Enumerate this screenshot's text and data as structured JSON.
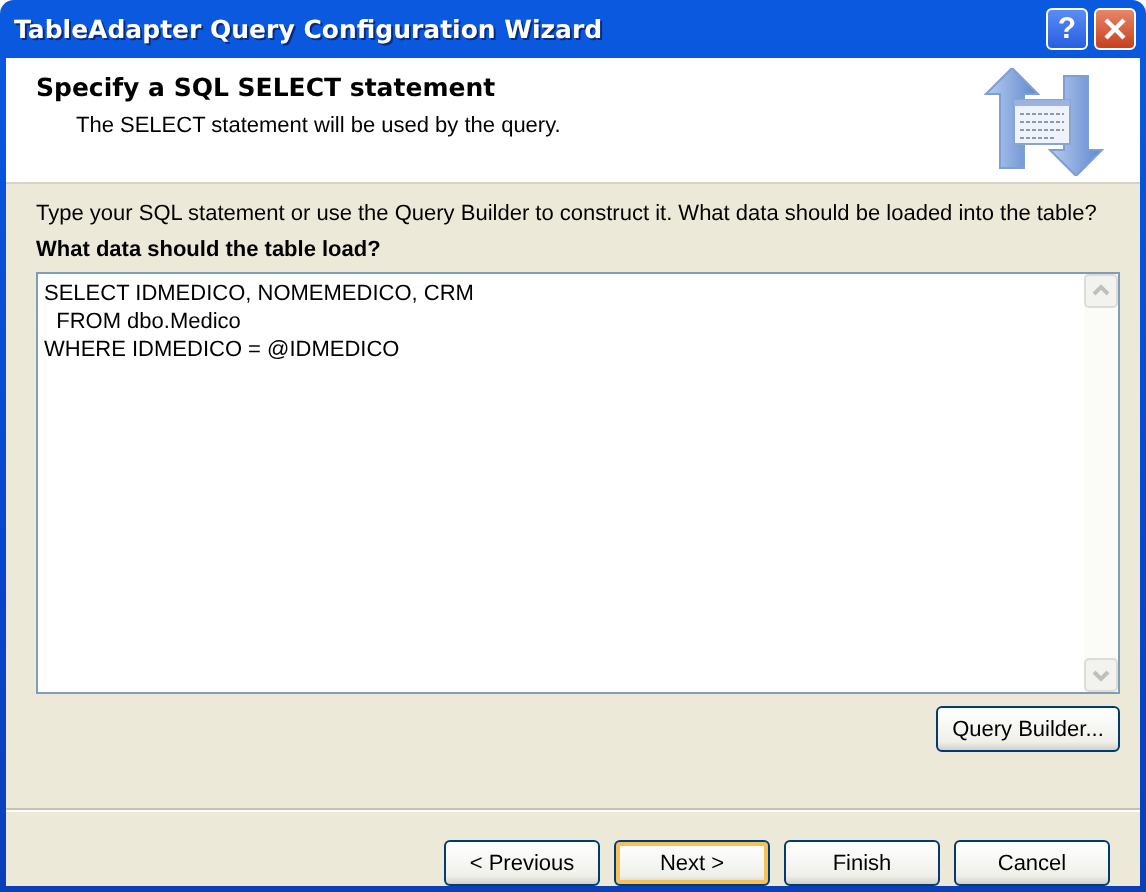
{
  "window": {
    "title": "TableAdapter Query Configuration Wizard",
    "controls": [
      {
        "kind": "help",
        "label": "?"
      },
      {
        "kind": "close"
      }
    ]
  },
  "header": {
    "title": "Specify a SQL SELECT statement",
    "subtitle": "The SELECT statement will be used by the query."
  },
  "instructions": "Type your SQL statement or use the Query Builder to construct it. What data should be loaded into the table?",
  "query_label": "What data should the table load?",
  "query_field": {
    "value": "SELECT IDMEDICO, NOMEMEDICO, CRM\n  FROM dbo.Medico\nWHERE IDMEDICO = @IDMEDICO"
  },
  "query_builder_button": "Query Builder...",
  "buttons": [
    {
      "label": "< Previous",
      "default": false
    },
    {
      "label": "Next >",
      "default": true
    },
    {
      "label": "Finish",
      "default": false
    },
    {
      "label": "Cancel",
      "default": false
    }
  ]
}
